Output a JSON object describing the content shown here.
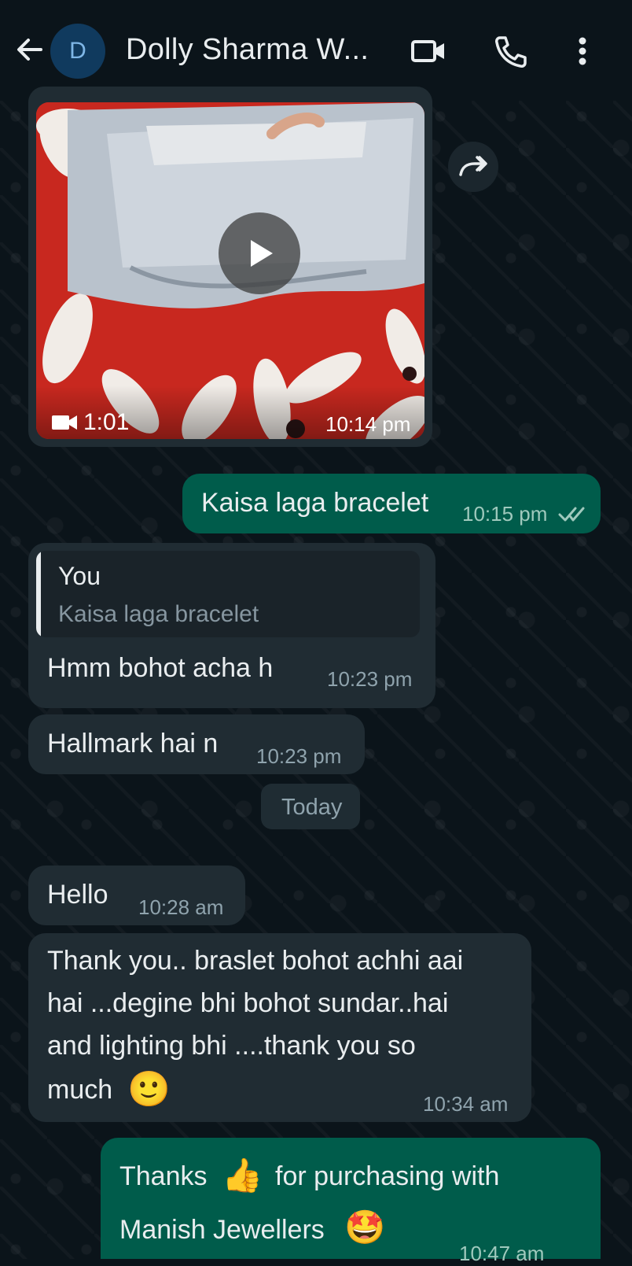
{
  "header": {
    "avatar_letter": "D",
    "contact_name": "Dolly Sharma W...",
    "icons": [
      "back-arrow-icon",
      "video-call-icon",
      "voice-call-icon",
      "more-options-icon"
    ]
  },
  "messages": {
    "video": {
      "duration": "1:01",
      "time": "10:14 pm"
    },
    "out1": {
      "text": "Kaisa laga bracelet",
      "time": "10:15 pm",
      "status": "read"
    },
    "in1": {
      "quote_author": "You",
      "quote_text": "Kaisa laga bracelet",
      "text": "Hmm bohot acha h",
      "time": "10:23 pm"
    },
    "in2": {
      "text": "Hallmark hai n",
      "time": "10:23 pm"
    },
    "day_separator": "Today",
    "in3": {
      "text": "Hello",
      "time": "10:28 am"
    },
    "in4": {
      "line1": "Thank you.. braslet bohot achhi aai",
      "line2": "hai ...degine bhi bohot sundar..hai",
      "line3": "and lighting bhi ....thank you so",
      "line4": "much",
      "emoji": "🙂",
      "time": "10:34 am"
    },
    "out2": {
      "part1": "Thanks",
      "emoji1": "👍",
      "part2": "for purchasing with",
      "line2": "Manish Jewellers",
      "emoji2": "🤩",
      "time": "10:47 am"
    }
  },
  "colors": {
    "background": "#0b141a",
    "incoming_bubble": "#202c33",
    "outgoing_bubble": "#005c4b",
    "read_ticks": "#9fc9bd"
  }
}
